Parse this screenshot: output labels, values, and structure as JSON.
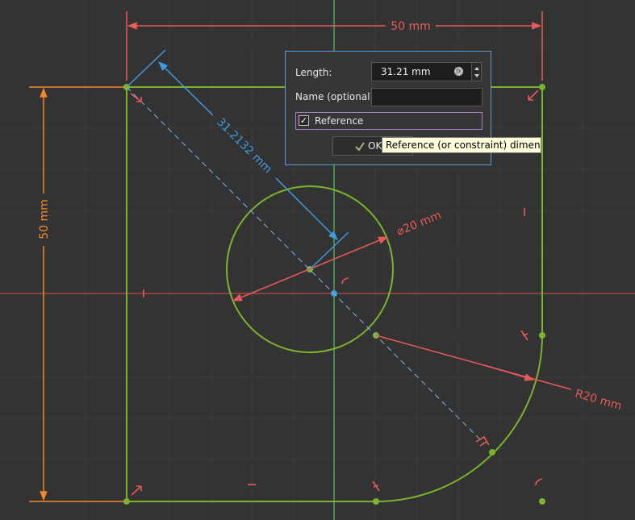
{
  "colors": {
    "background": "#333333",
    "geometry": "#7ab32e",
    "axis_horizontal": "#e05151",
    "axis_vertical": "#5fe05f",
    "dimension_driving": "#e85a5a",
    "dimension_orange": "#f08a2a",
    "reference_dimension": "#3f9be0"
  },
  "dimensions": {
    "top_width": "50 mm",
    "left_height": "50 mm",
    "circle_diameter": "⌀20 mm",
    "corner_radius": "R20 mm",
    "reference_length": "31.2132 mm"
  },
  "dialog": {
    "length_label": "Length:",
    "length_value": "31.21 mm",
    "fx_label": "ƒx",
    "name_label": "Name (optional)",
    "name_value": "",
    "reference_label": "Reference",
    "reference_checked": true,
    "check_mark": "✓",
    "ok_label": "OK"
  },
  "tooltip": {
    "text": "Reference (or constraint) dimension"
  }
}
